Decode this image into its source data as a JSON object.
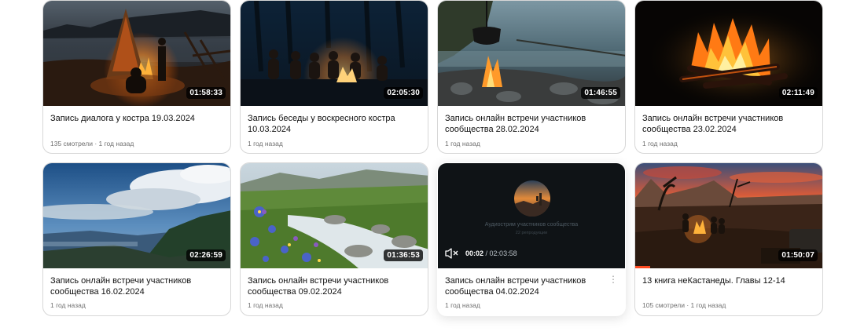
{
  "videos": [
    {
      "title": "Запись диалога у костра 19.03.2024",
      "meta": "135 смотрели · 1 год назад",
      "duration": "01:58:33",
      "thumb": "campfire-lake-night"
    },
    {
      "title": "Запись беседы у воскресного костра 10.03.2024",
      "meta": "1 год назад",
      "duration": "02:05:30",
      "thumb": "group-around-campfire"
    },
    {
      "title": "Запись онлайн встречи участников сообщества 28.02.2024",
      "meta": "1 год назад",
      "duration": "01:46:55",
      "thumb": "kettle-over-fire-by-lake"
    },
    {
      "title": "Запись онлайн встречи участников сообщества 23.02.2024",
      "meta": "1 год назад",
      "duration": "02:11:49",
      "thumb": "bonfire-in-dark"
    },
    {
      "title": "Запись онлайн встречи участников сообщества 16.02.2024",
      "meta": "1 год назад",
      "duration": "02:26:59",
      "thumb": "sky-over-mountains"
    },
    {
      "title": "Запись онлайн встречи участников сообщества 09.02.2024",
      "meta": "1 год назад",
      "duration": "01:36:53",
      "thumb": "mountain-stream-flowers"
    },
    {
      "title": "Запись онлайн встречи участников сообщества 04.02.2024",
      "meta": "1 год назад",
      "thumb": "audio-stream-player",
      "player": {
        "stream_title": "Аудиострим участников сообщества",
        "stream_sub": "22 репродукции",
        "current_time": "00:02",
        "separator": " / ",
        "total_time": "02:03:58"
      }
    },
    {
      "title": "13 книга неКастанеды. Главы 12-14",
      "meta": "105 смотрели · 1 год назад",
      "duration": "01:50:07",
      "thumb": "desert-campfire-sunset",
      "watched_fraction": 0.08
    }
  ],
  "colors": {
    "progress": "#ff4a20",
    "card_border": "#d7d7d7"
  }
}
